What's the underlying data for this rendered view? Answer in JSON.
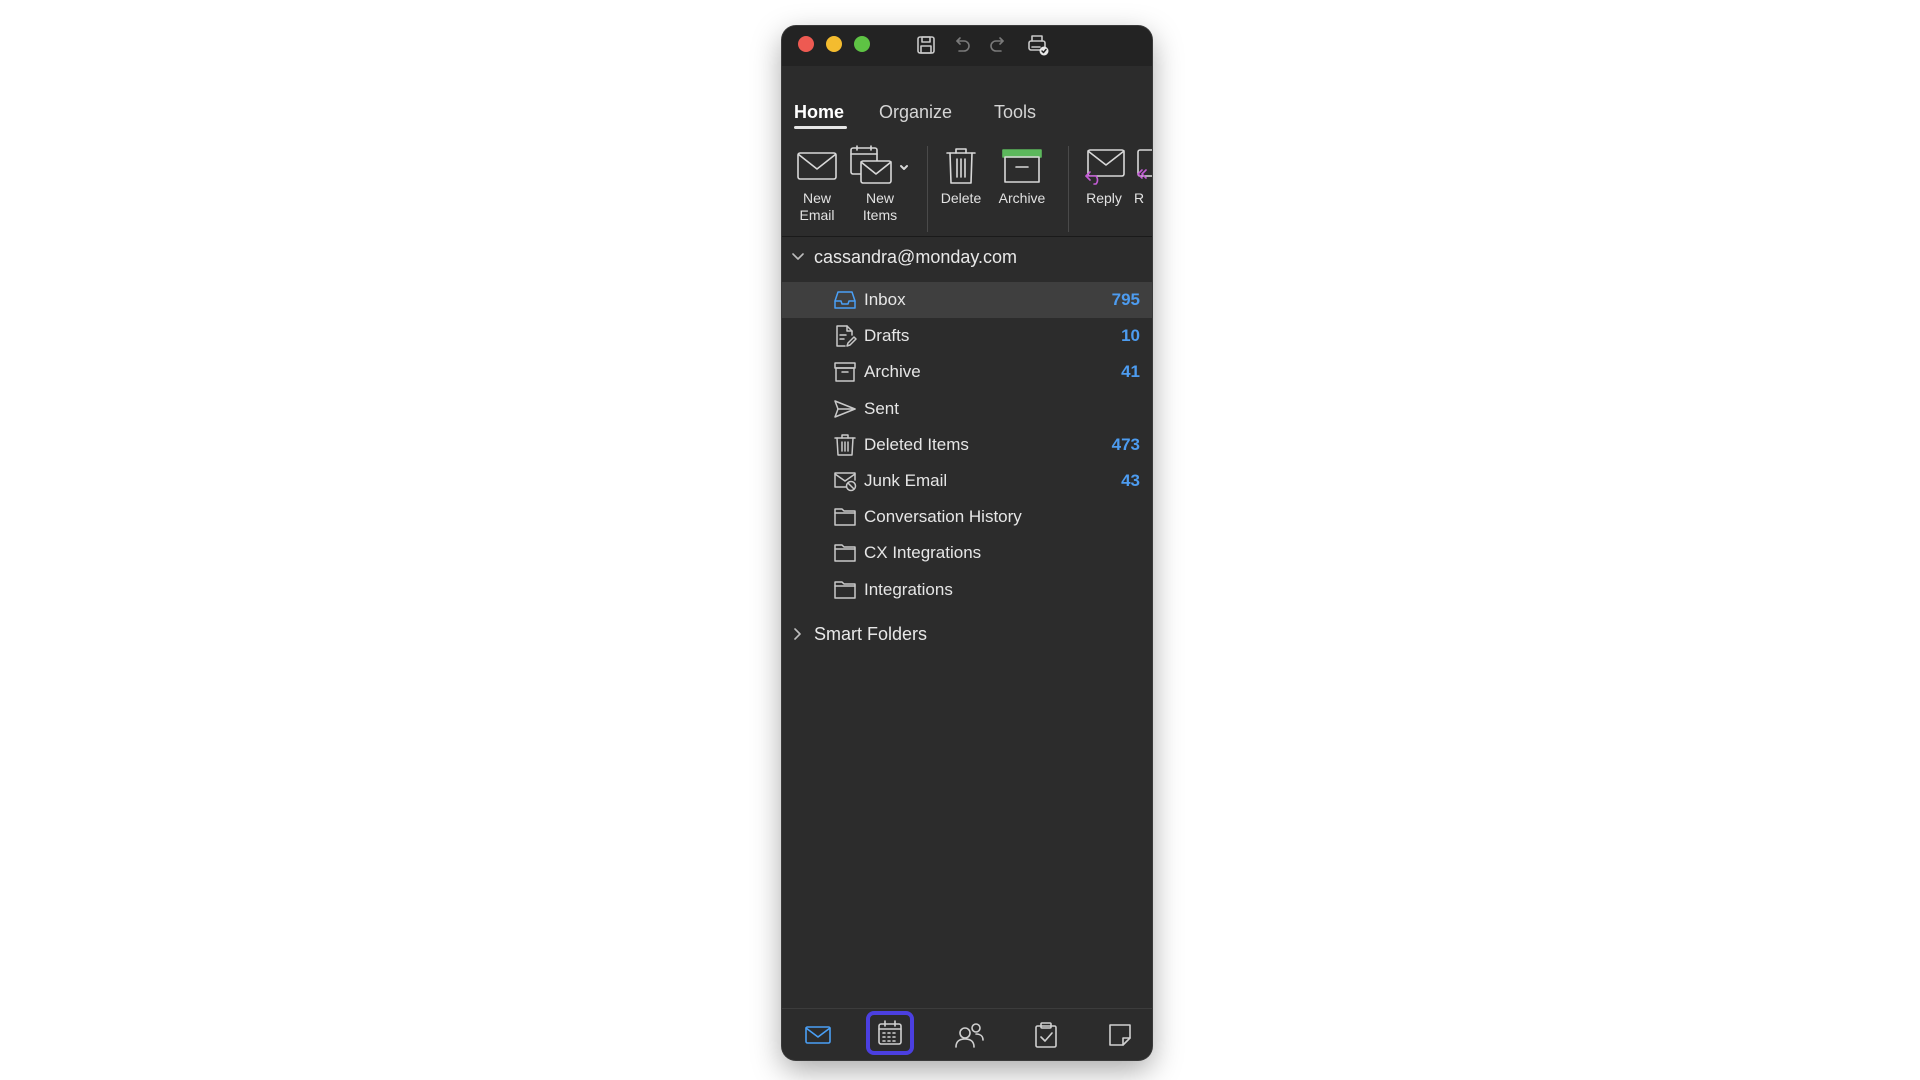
{
  "window": {
    "traffic_lights": [
      "close",
      "minimize",
      "zoom"
    ],
    "quick_access": [
      "save-icon",
      "undo-icon",
      "redo-icon",
      "print-icon"
    ]
  },
  "tabs": [
    {
      "label": "Home",
      "active": true
    },
    {
      "label": "Organize",
      "active": false
    },
    {
      "label": "Tools",
      "active": false
    }
  ],
  "ribbon": {
    "new_email": "New\nEmail",
    "new_items": "New\nItems",
    "delete": "Delete",
    "archive": "Archive",
    "reply": "Reply",
    "reply_all_partial": "R"
  },
  "account": {
    "email": "cassandra@monday.com",
    "expanded": true
  },
  "folders": [
    {
      "name": "Inbox",
      "count": "795",
      "icon": "inbox-icon",
      "selected": true
    },
    {
      "name": "Drafts",
      "count": "10",
      "icon": "drafts-icon"
    },
    {
      "name": "Archive",
      "count": "41",
      "icon": "archive-icon"
    },
    {
      "name": "Sent",
      "count": "",
      "icon": "sent-icon"
    },
    {
      "name": "Deleted Items",
      "count": "473",
      "icon": "trash-icon"
    },
    {
      "name": "Junk Email",
      "count": "43",
      "icon": "junk-icon"
    },
    {
      "name": "Conversation History",
      "count": "",
      "icon": "folder-icon"
    },
    {
      "name": "CX Integrations",
      "count": "",
      "icon": "folder-icon"
    },
    {
      "name": "Integrations",
      "count": "",
      "icon": "folder-icon"
    }
  ],
  "smart_folders": {
    "label": "Smart Folders",
    "expanded": false
  },
  "bottom_nav": [
    "mail-icon",
    "calendar-icon",
    "people-icon",
    "tasks-icon",
    "notes-icon"
  ],
  "colors": {
    "accent": "#4a9ff5",
    "focus_ring": "#4b3fe0",
    "background": "#2c2c2c",
    "archive_green": "#5cb85c"
  }
}
